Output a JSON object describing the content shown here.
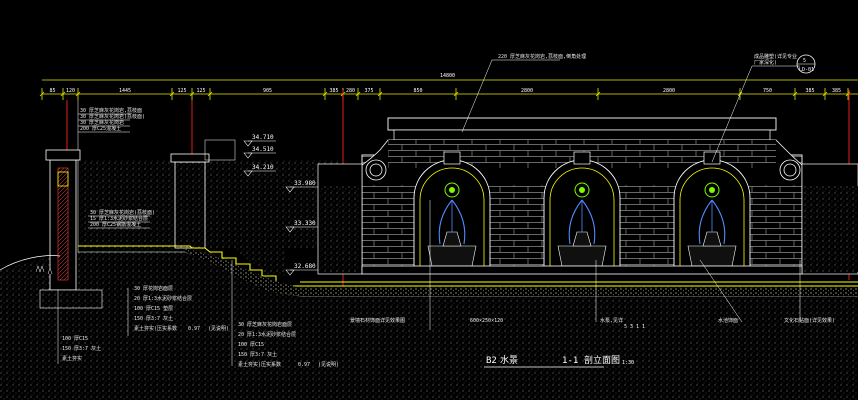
{
  "drawing": {
    "title_code": "B2",
    "title_text": "水景",
    "section_mark": "1-1",
    "section_name": "剖立面图",
    "scale": "1:30",
    "detail_index": "5",
    "detail_sheet": "LD-01"
  },
  "dimensions": {
    "top_row": [
      "85",
      "120",
      "1445",
      "125",
      "125",
      "905",
      "385",
      "280",
      "375",
      "850",
      "2800",
      "2800",
      "750",
      "385",
      "385"
    ],
    "overall": "14800"
  },
  "levels": [
    {
      "value": "34.710"
    },
    {
      "value": "34.510"
    },
    {
      "value": "34.210"
    },
    {
      "value": "33.980"
    },
    {
      "value": "33.330"
    },
    {
      "value": "32.680"
    }
  ],
  "notes": {
    "cap_top_1": "30 厚芝麻灰花岗岩,荔枝面",
    "cap_top_2": "30 厚芝麻灰花岗岩(荔枝面)",
    "cap_top_3": "30 厚芝麻灰花岗岩",
    "cap_top_4": "200 厚C25混凝土",
    "wall_1": "30 厚芝麻灰花岗岩(荔枝面)",
    "wall_2": "15 厚1:3水泥砂浆结合层",
    "wall_3": "200 厚C25钢筋混凝土",
    "base_1": "100 厚C15",
    "base_2": "150 厚3:7 灰土",
    "base_3": "素土夯实",
    "stair_1": "30 厚花岗岩面层",
    "stair_2": "20 厚1:3水泥砂浆结合层",
    "stair_3": "100 厚C15 垫层",
    "stair_4": "150 厚3:7 灰土",
    "stair_5": "素土夯实(压实系数",
    "stair_5b": "0.97",
    "stair_5c": "(见说明)",
    "pool_1": "30 厚芝麻灰花岗岩面层",
    "pool_2": "20 厚1:3水泥砂浆结合层",
    "pool_3": "100 厚C15",
    "pool_4": "150 厚3:7 灰土",
    "pool_5": "素土夯实(压实系数",
    "pool_5b": "0.97",
    "pool_5c": "(见说明)",
    "ground_1": "芝麻灰花岗岩压顶",
    "ground_2": "600×250×120",
    "ground_3": "芝麻灰花岗岩",
    "leader_top": "220 厚芝麻灰花岗岩,荔枝面,倒角处理",
    "leader_right_1": "成品雕塑(详见专业",
    "leader_right_2": "厂家深化)",
    "bottom_a": "景墙石材饰面详见效果图",
    "bottom_b": "600×250×120",
    "bottom_c": "水泵,见详",
    "bottom_d": "5 3 1 1",
    "bottom_e": "水池饰面",
    "bottom_f": "文化石贴面(详见效果)",
    "dim_small_1": "10",
    "dim_small_2": "400"
  }
}
